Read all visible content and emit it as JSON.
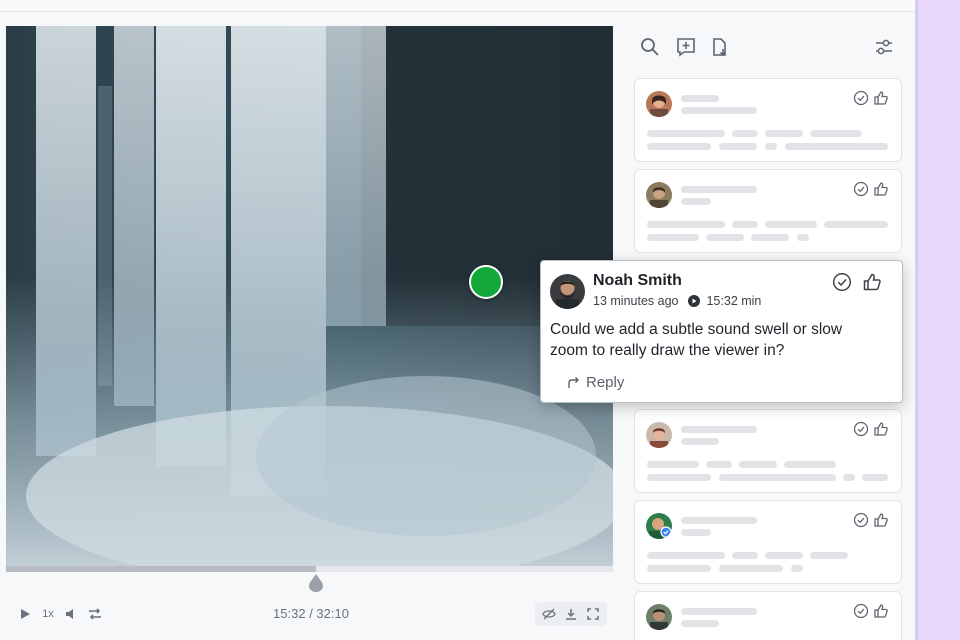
{
  "player": {
    "speed_label": "1x",
    "time_current": "15:32",
    "time_total": "32:10",
    "time_separator": " / ",
    "progress": 0.51
  },
  "popup": {
    "author": "Noah Smith",
    "time_ago": "13 minutes ago",
    "timestamp": "15:32 min",
    "body": "Could we add a subtle sound swell or slow zoom to really draw the viewer in?",
    "reply_label": "Reply"
  },
  "icons": {
    "toolbar": [
      "search-icon",
      "add-comment-icon",
      "export-icon",
      "filter-sliders-icon"
    ],
    "card_actions": [
      "resolve-check-icon",
      "thumbs-up-icon"
    ]
  },
  "colors": {
    "marker_green": "#12a83a",
    "sidebar_lavender": "#e8d9fb"
  }
}
